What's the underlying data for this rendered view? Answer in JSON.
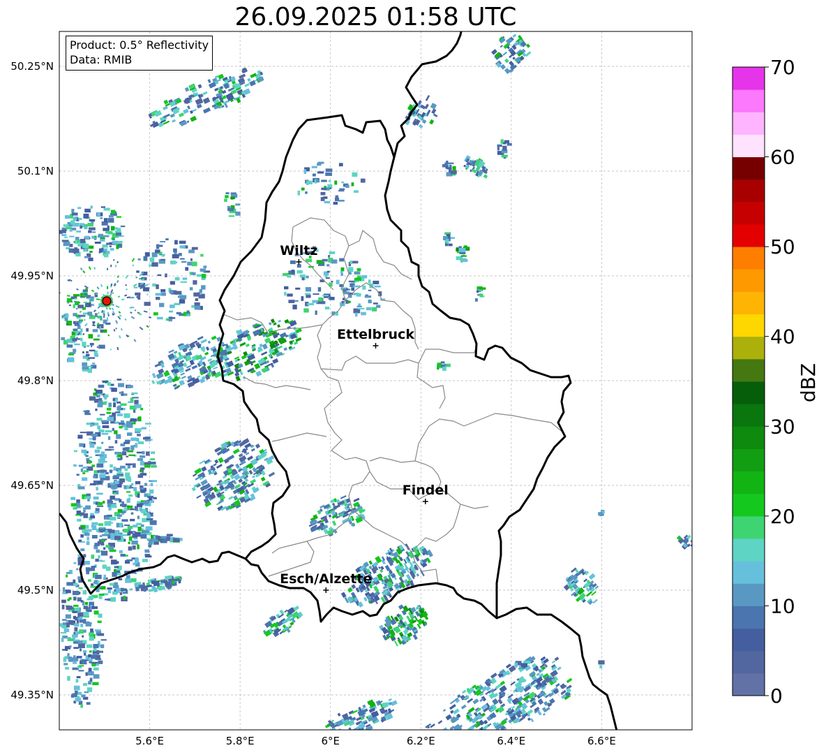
{
  "title": "26.09.2025 01:58 UTC",
  "info": {
    "product": "Product: 0.5° Reflectivity",
    "data": "Data: RMIB"
  },
  "map": {
    "lon_range": [
      5.4,
      6.8
    ],
    "lat_range": [
      49.3,
      50.3
    ],
    "grid": true,
    "lat_ticks": [
      {
        "value": 50.25,
        "label": "50.25°N"
      },
      {
        "value": 50.1,
        "label": "50.1°N"
      },
      {
        "value": 49.95,
        "label": "49.95°N"
      },
      {
        "value": 49.8,
        "label": "49.8°N"
      },
      {
        "value": 49.65,
        "label": "49.65°N"
      },
      {
        "value": 49.5,
        "label": "49.5°N"
      },
      {
        "value": 49.35,
        "label": "49.35°N"
      }
    ],
    "lon_ticks": [
      {
        "value": 5.6,
        "label": "5.6°E"
      },
      {
        "value": 5.8,
        "label": "5.8°E"
      },
      {
        "value": 6.0,
        "label": "6°E"
      },
      {
        "value": 6.2,
        "label": "6.2°E"
      },
      {
        "value": 6.4,
        "label": "6.4°E"
      },
      {
        "value": 6.6,
        "label": "6.6°E"
      }
    ],
    "cities": [
      {
        "name": "Wiltz",
        "lon": 5.93,
        "lat": 49.97
      },
      {
        "name": "Ettelbruck",
        "lon": 6.1,
        "lat": 49.85
      },
      {
        "name": "Findel",
        "lon": 6.21,
        "lat": 49.627
      },
      {
        "name": "Esch/Alzette",
        "lon": 5.99,
        "lat": 49.5
      }
    ],
    "radar_site": {
      "lon": 5.505,
      "lat": 49.914,
      "color": "#e8140e"
    }
  },
  "colorbar": {
    "label": "dBZ",
    "min": 0,
    "max": 70,
    "step": 2.5,
    "tick_values": [
      0,
      10,
      20,
      30,
      40,
      50,
      60,
      70
    ],
    "tick_labels": [
      "0",
      "10",
      "20",
      "30",
      "40",
      "50",
      "60",
      "70"
    ],
    "colors": [
      "#6272a6",
      "#5266a0",
      "#445ea0",
      "#4b75ae",
      "#5a98c4",
      "#66c0dc",
      "#5ed4c4",
      "#3ed472",
      "#14c81e",
      "#12b414",
      "#129e12",
      "#0e8a0e",
      "#0a760e",
      "#065e0a",
      "#457810",
      "#acb00a",
      "#fed700",
      "#feb402",
      "#fe9a00",
      "#fe7e00",
      "#e40000",
      "#c60000",
      "#a80000",
      "#760000",
      "#fee2fe",
      "#feb4fe",
      "#fc78fc",
      "#e634ea"
    ]
  }
}
